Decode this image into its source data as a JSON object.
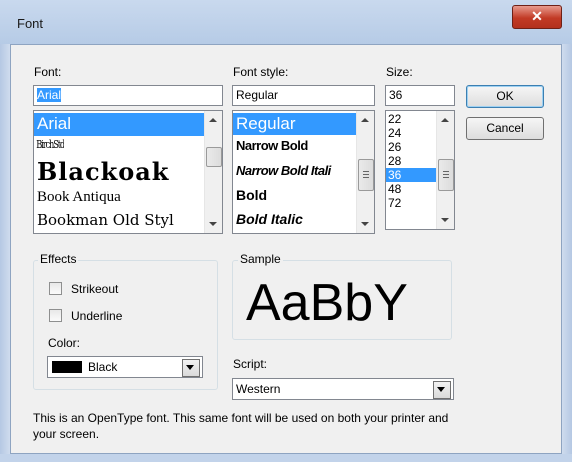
{
  "window": {
    "title": "Font",
    "close_icon": "close-icon"
  },
  "font": {
    "label": "Font:",
    "value": "Arial",
    "items": [
      "Arial",
      "BirchStd",
      "Blackoak",
      "Book Antiqua",
      "Bookman Old Styl"
    ]
  },
  "style": {
    "label": "Font style:",
    "value": "Regular",
    "items": [
      "Regular",
      "Narrow Bold",
      "Narrow Bold Itali",
      "Bold",
      "Bold Italic"
    ]
  },
  "size": {
    "label": "Size:",
    "value": "36",
    "items": [
      "22",
      "24",
      "26",
      "28",
      "36",
      "48",
      "72"
    ]
  },
  "buttons": {
    "ok": "OK",
    "cancel": "Cancel"
  },
  "effects": {
    "legend": "Effects",
    "strikeout": "Strikeout",
    "underline": "Underline",
    "color_label": "Color:",
    "color_value": "Black",
    "color_hex": "#000000"
  },
  "sample": {
    "legend": "Sample",
    "text": "AaBbY"
  },
  "script": {
    "label": "Script:",
    "value": "Western"
  },
  "description": "This is an OpenType font. This same font will be used on both your printer and your screen."
}
